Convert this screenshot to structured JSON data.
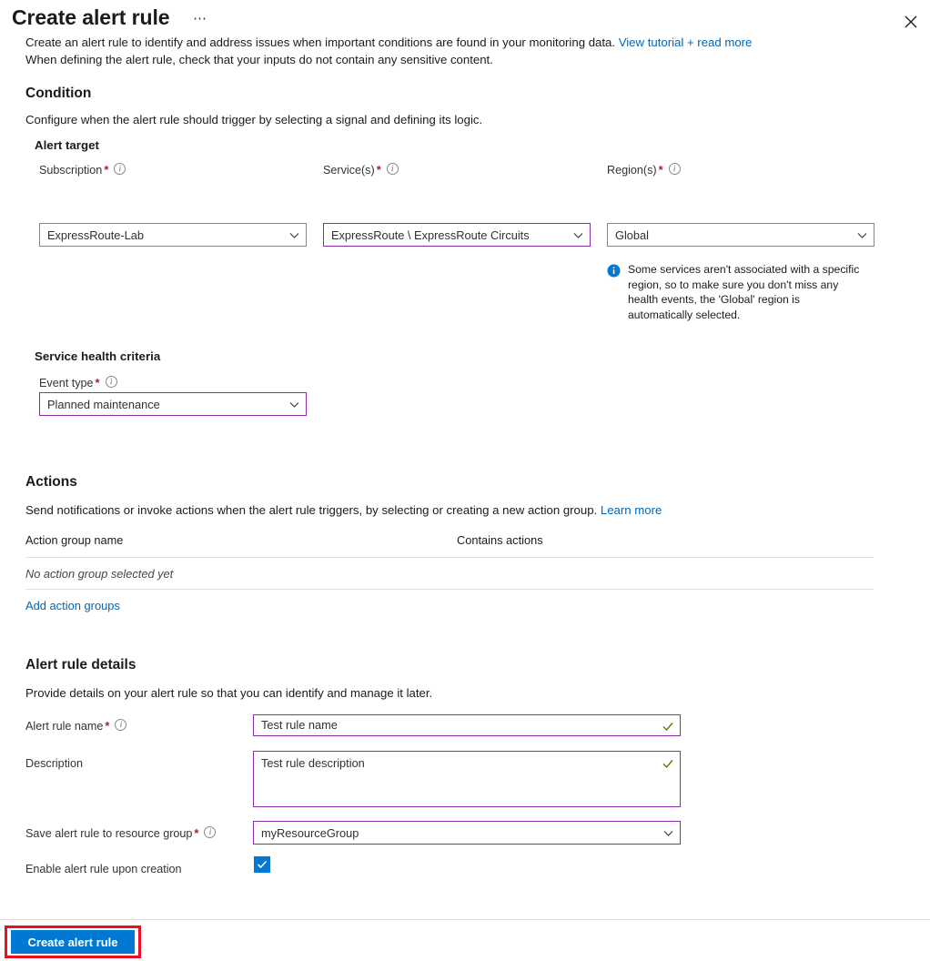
{
  "header": {
    "title": "Create alert rule",
    "ellipsis_label": "⋯",
    "close_icon": "close-icon"
  },
  "intro": {
    "line1_pre": "Create an alert rule to identify and address issues when important conditions are found in your monitoring data. ",
    "link_text": "View tutorial + read more",
    "line2": "When defining the alert rule, check that your inputs do not contain any sensitive content."
  },
  "condition": {
    "title": "Condition",
    "description": "Configure when the alert rule should trigger by selecting a signal and defining its logic.",
    "alert_target_title": "Alert target",
    "fields": {
      "subscription": {
        "label": "Subscription",
        "required": "*",
        "value": "ExpressRoute-Lab",
        "info_icon": "info-icon",
        "chevron_icon": "chevron-down-icon"
      },
      "services": {
        "label": "Service(s)",
        "required": "*",
        "value": "ExpressRoute \\ ExpressRoute Circuits",
        "info_icon": "info-icon",
        "chevron_icon": "chevron-down-icon"
      },
      "regions": {
        "label": "Region(s)",
        "required": "*",
        "value": "Global",
        "info_icon": "info-icon",
        "chevron_icon": "chevron-down-icon"
      }
    },
    "region_callout": {
      "icon": "info-circle-icon",
      "text": "Some services aren't associated with a specific region, so to make sure you don't miss any health events, the 'Global' region is automatically selected."
    },
    "service_health_criteria_title": "Service health criteria",
    "event_type": {
      "label": "Event type",
      "required": "*",
      "value": "Planned maintenance",
      "info_icon": "info-icon",
      "chevron_icon": "chevron-down-icon"
    }
  },
  "actions": {
    "title": "Actions",
    "description_pre": "Send notifications or invoke actions when the alert rule triggers, by selecting or creating a new action group. ",
    "learn_more": "Learn more",
    "table": {
      "columns": [
        "Action group name",
        "Contains actions"
      ],
      "empty_row": "No action group selected yet"
    },
    "add_link": "Add action groups"
  },
  "alert_rule_details": {
    "title": "Alert rule details",
    "description": "Provide details on your alert rule so that you can identify and manage it later.",
    "rule_name": {
      "label": "Alert rule name",
      "required": "*",
      "value": "Test rule name",
      "info_icon": "info-icon",
      "valid_icon": "checkmark-icon"
    },
    "description_field": {
      "label": "Description",
      "value": "Test rule description",
      "valid_icon": "checkmark-icon"
    },
    "resource_group": {
      "label": "Save alert rule to resource group",
      "required": "*",
      "value": "myResourceGroup",
      "info_icon": "info-icon",
      "chevron_icon": "chevron-down-icon"
    },
    "enable_rule": {
      "label": "Enable alert rule upon creation",
      "checked": true,
      "check_icon": "checkmark-icon"
    }
  },
  "footer": {
    "create_button": "Create alert rule"
  },
  "colors": {
    "accent_blue": "#0078d4",
    "link_blue": "#0067b8",
    "purple_border": "#8c2da8",
    "gray_border": "#8a8886",
    "required_red": "#a4262c",
    "highlight_red": "#e81123",
    "valid_green": "#498205"
  }
}
